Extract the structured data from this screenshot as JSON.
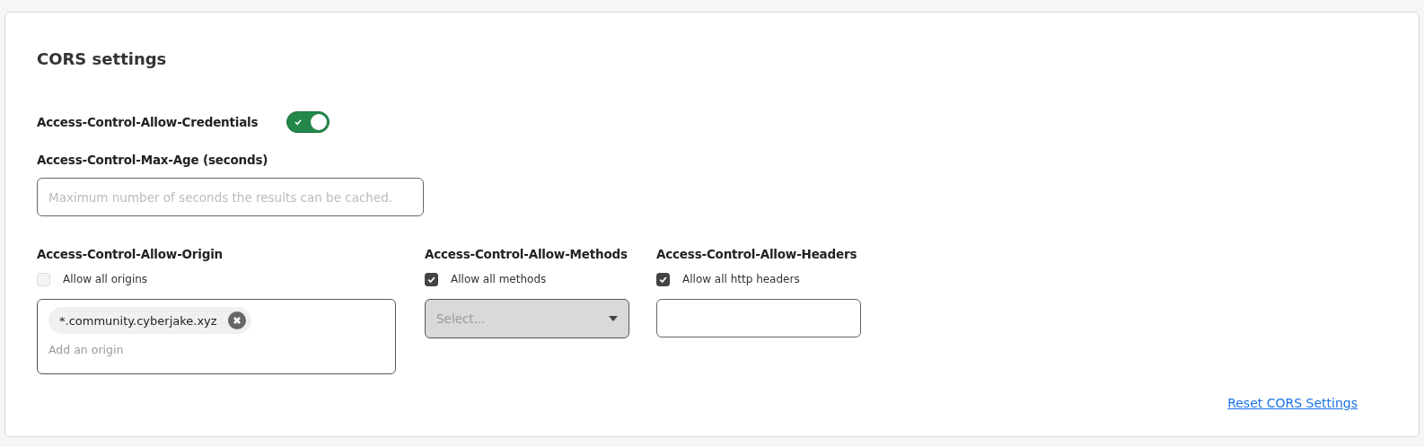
{
  "title": "CORS settings",
  "credentials": {
    "label": "Access-Control-Allow-Credentials",
    "on": true
  },
  "max_age": {
    "label": "Access-Control-Max-Age (seconds)",
    "placeholder": "Maximum number of seconds the results can be cached."
  },
  "columns": [
    {
      "kind": "tags",
      "label": "Access-Control-Allow-Origin",
      "allow_all": {
        "label": "Allow all origins",
        "checked": false
      },
      "tags": [
        "*.community.cyberjake.xyz"
      ],
      "placeholder": "Add an origin"
    },
    {
      "kind": "select",
      "label": "Access-Control-Allow-Methods",
      "allow_all": {
        "label": "Allow all methods",
        "checked": true
      },
      "placeholder": "Select...",
      "disabled": true
    },
    {
      "kind": "text",
      "label": "Access-Control-Allow-Headers",
      "allow_all": {
        "label": "Allow all http headers",
        "checked": true
      }
    }
  ],
  "reset_link": "Reset CORS Settings"
}
